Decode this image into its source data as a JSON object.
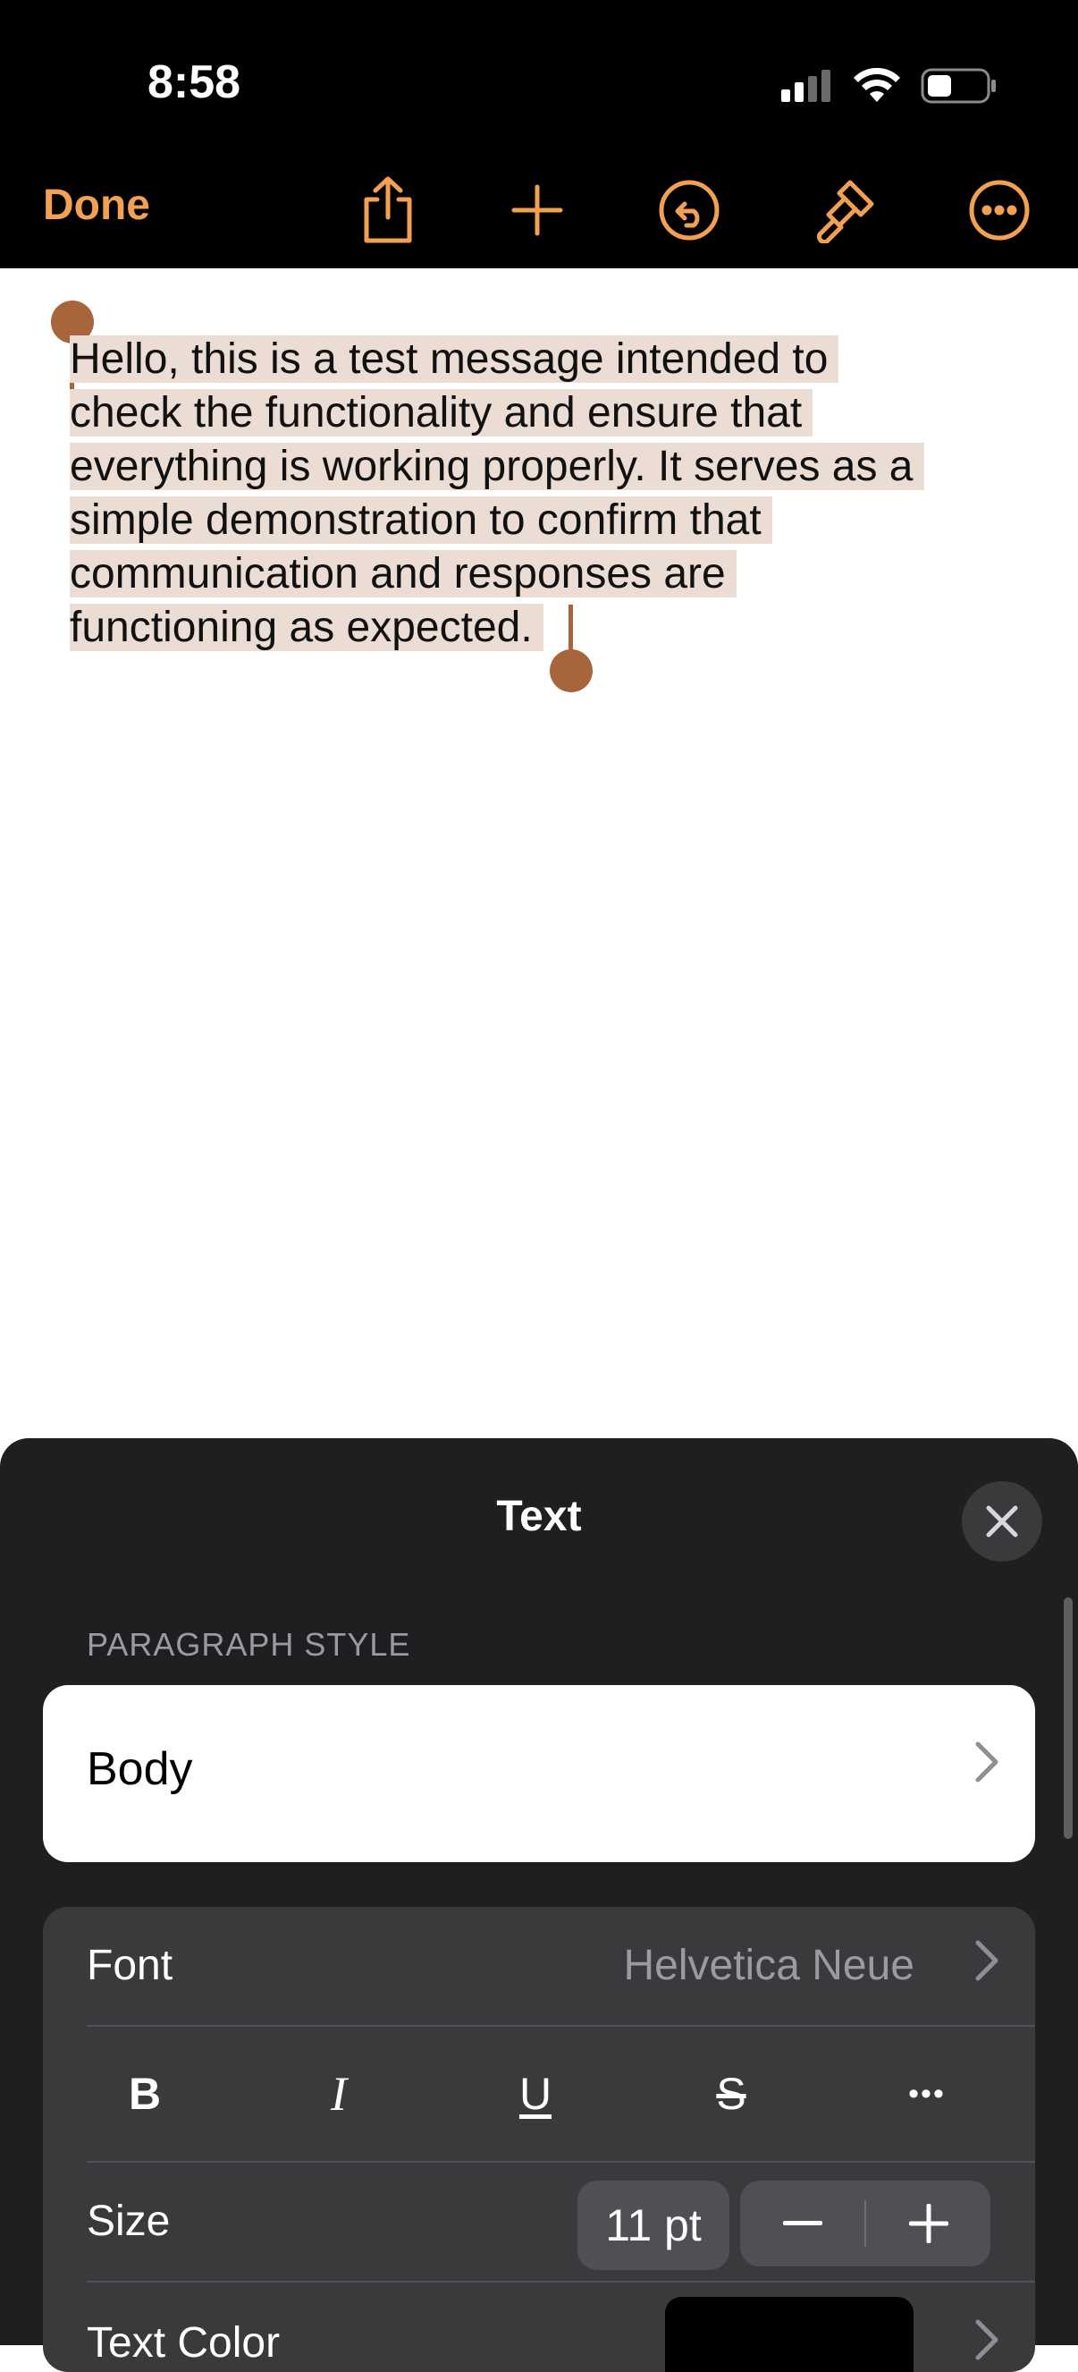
{
  "status_bar": {
    "time": "8:58"
  },
  "toolbar": {
    "done_label": "Done"
  },
  "document": {
    "lines": [
      "Hello, this is a test message intended to",
      "check the functionality and ensure that",
      "everything is working properly. It serves as a",
      "simple demonstration to confirm that",
      "communication and responses are",
      "functioning as expected."
    ]
  },
  "sheet": {
    "title": "Text",
    "paragraph_style_header": "PARAGRAPH STYLE",
    "paragraph_style_value": "Body",
    "font_label": "Font",
    "font_value": "Helvetica Neue",
    "style_buttons": [
      "B",
      "I",
      "U",
      "S",
      "•••"
    ],
    "size_label": "Size",
    "size_value": "11 pt",
    "text_color_label": "Text Color"
  },
  "colors": {
    "accent": "#F2A052",
    "selection": "#EBDDD3",
    "handle": "#A8643A",
    "sheet_bg": "#1F1F21"
  }
}
